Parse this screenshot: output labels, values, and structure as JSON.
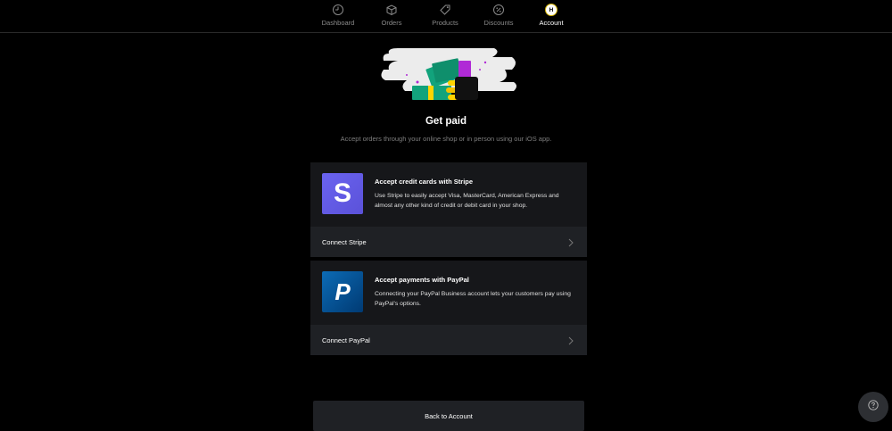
{
  "nav": {
    "items": [
      {
        "label": "Dashboard",
        "icon": "dashboard-gauge-icon"
      },
      {
        "label": "Orders",
        "icon": "box-icon"
      },
      {
        "label": "Products",
        "icon": "tag-icon"
      },
      {
        "label": "Discounts",
        "icon": "percent-badge-icon"
      },
      {
        "label": "Account",
        "icon": "avatar"
      }
    ],
    "active": "Account",
    "avatar_initial": "H"
  },
  "hero": {
    "title": "Get paid",
    "subtitle": "Accept orders through your online shop or in person using our iOS app."
  },
  "cards": [
    {
      "heading": "Accept credit cards with Stripe",
      "description": "Use Stripe to easily accept Visa, MasterCard, American Express and almost any other kind of credit or debit card in your shop.",
      "action": "Connect Stripe",
      "logo_letter": "S",
      "logo_color": "#635bff"
    },
    {
      "heading": "Accept payments with PayPal",
      "description": "Connecting your PayPal Business account lets your customers pay using PayPal's options.",
      "action": "Connect PayPal",
      "logo_letter": "P",
      "logo_color": "#0c6bb5"
    }
  ],
  "back_button": "Back to Account",
  "colors": {
    "background": "#000000",
    "card": "#16171a",
    "card_action": "#1f2125",
    "accent_ring": "#d4b400"
  }
}
